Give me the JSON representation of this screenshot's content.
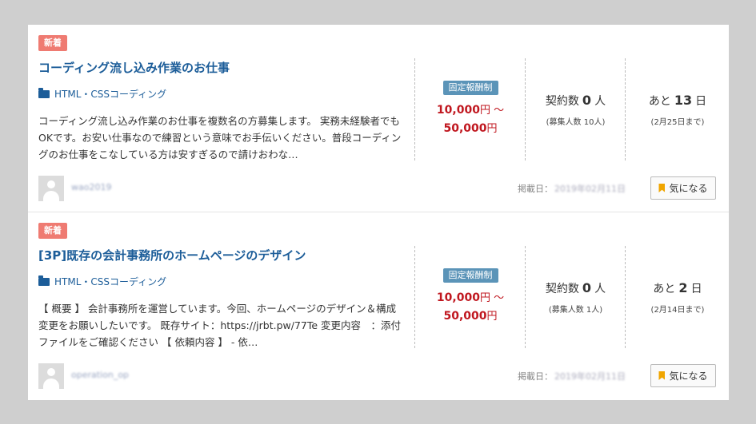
{
  "jobs": [
    {
      "badge": "新着",
      "title": "コーディング流し込み作業のお仕事",
      "category": "HTML・CSSコーディング",
      "description": "コーディング流し込み作業のお仕事を複数名の方募集します。 実務未経験者でもOKです。お安い仕事なので練習という意味でお手伝いください。普段コーディングのお仕事をこなしている方は安すぎるので請けおわな…",
      "pay_type": "固定報酬制",
      "price_min": "10,000",
      "price_min_unit": "円 ～",
      "price_max": "50,000",
      "price_max_unit": "円",
      "contracts_label": "契約数",
      "contracts": "0",
      "contracts_unit": "人",
      "recruit": "(募集人数 10人)",
      "remain_label": "あと",
      "remain_days": "13",
      "remain_unit": "日",
      "deadline": "(2月25日まで)",
      "user": "wao2019",
      "posted_label": "掲載日：",
      "posted_date": "2019年02月11日",
      "fav_label": "気になる"
    },
    {
      "badge": "新着",
      "title": "[3P]既存の会計事務所のホームページのデザイン",
      "category": "HTML・CSSコーディング",
      "description": "【 概要 】 会計事務所を運営しています。今回、ホームページのデザイン＆構成変更をお願いしたいです。 既存サイト：https://jrbt.pw/77Te 変更内容　：添付ファイルをご確認ください 【 依頼内容 】 - 依…",
      "pay_type": "固定報酬制",
      "price_min": "10,000",
      "price_min_unit": "円 ～",
      "price_max": "50,000",
      "price_max_unit": "円",
      "contracts_label": "契約数",
      "contracts": "0",
      "contracts_unit": "人",
      "recruit": "(募集人数 1人)",
      "remain_label": "あと",
      "remain_days": "2",
      "remain_unit": "日",
      "deadline": "(2月14日まで)",
      "user": "operation_op",
      "posted_label": "掲載日：",
      "posted_date": "2019年02月11日",
      "fav_label": "気になる"
    }
  ],
  "colors": {
    "accent": "#1c5d99",
    "new_badge": "#ef7b72",
    "price": "#c0171f",
    "pay_badge": "#5b94b8",
    "bookmark": "#f0a500"
  }
}
